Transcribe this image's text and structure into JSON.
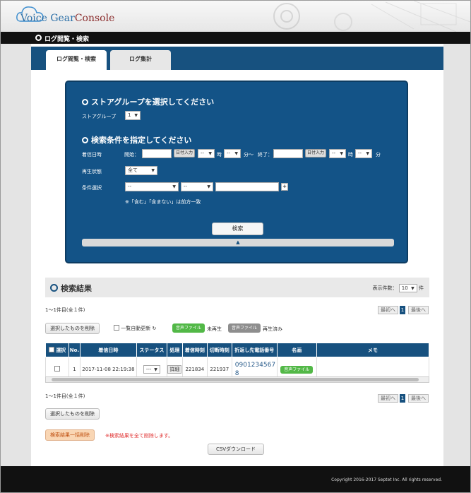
{
  "app": {
    "logo_text_a": "Voice ",
    "logo_text_b": "Gear",
    "logo_text_c": "Console",
    "page_title": "ログ閲覧・検索"
  },
  "tabs": [
    {
      "label": "ログ閲覧・検索"
    },
    {
      "label": "ログ集計"
    }
  ],
  "search": {
    "section1_title": "ストアグループを選択してください",
    "store_group_label": "ストアグループ",
    "store_group_value": "1",
    "section2_title": "検索条件を指定してください",
    "datetime_label": "着信日時",
    "start_label": "開始：",
    "date_button": "日付入力",
    "hour_sel": "--",
    "hour_unit": "時",
    "min_sel": "--",
    "min_unit": "分～",
    "end_label": "終了：",
    "min_unit_end": "分",
    "play_status_label": "再生状態",
    "play_status_value": "全て",
    "condition_label": "条件選択",
    "cond_sel1": "--",
    "cond_sel2": "--",
    "plus": "+",
    "note": "※「含む」「含まない」は前方一致",
    "search_button": "検索",
    "collapse_icon": "▲"
  },
  "results": {
    "title": "検索結果",
    "per_page_label": "表示件数：",
    "per_page_value": "10",
    "per_page_unit": "件",
    "count_text": "1～1件目(全１件)",
    "prev": "最初へ",
    "page": "1",
    "next": "最後へ",
    "delete_selected": "選択したものを削除",
    "auto_refresh": "一覧自動更新",
    "refresh_icon": "↻",
    "audio_badge": "音声ファイル",
    "unplayed": "未再生",
    "played": "再生済み",
    "columns": [
      "選択",
      "No.",
      "着信日時",
      "ステータス",
      "処理",
      "着信時刻",
      "切断時刻",
      "折返し先電話番号",
      "名画",
      "メモ"
    ],
    "rows": [
      {
        "no": "1",
        "datetime": "2017-11-08 22:19:38",
        "status": "---",
        "action": "詳細",
        "in_time": "221834",
        "cut_time": "221937",
        "phone": "09012345678",
        "file": "音声ファイル",
        "memo": ""
      }
    ],
    "count_text_bottom": "1～1件目(全１件)",
    "delete_selected_bottom": "選択したものを削除",
    "delete_all": "検索結果一括削除",
    "delete_all_note": "※検索結果を全て削除します。",
    "csv_button": "CSVダウンロード"
  },
  "footer": {
    "copyright": "Copyright 2016-2017 Septet Inc. All rights reserved."
  },
  "colors": {
    "primary": "#17517f",
    "green": "#52b847",
    "orange": "#f9d6b4"
  }
}
